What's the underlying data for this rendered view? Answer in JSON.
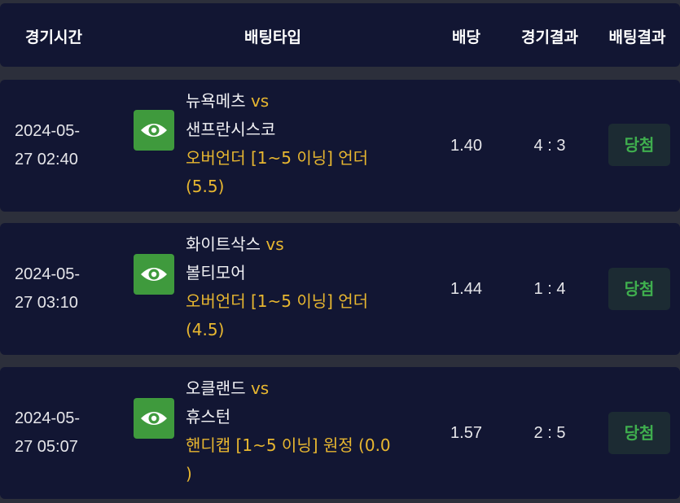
{
  "header": {
    "time": "경기시간",
    "bet_type": "배팅타입",
    "odds": "배당",
    "match_result": "경기결과",
    "bet_result": "배팅결과"
  },
  "rows": [
    {
      "date": "2024-05-",
      "time": "27 02:40",
      "home": "뉴욕메츠",
      "vs": "vs",
      "away": "샌프란시스코",
      "bet_line1": "오버언더 [1~5 이닝] 언더",
      "bet_line2": "(5.5)",
      "odds": "1.40",
      "score": "4 : 3",
      "result": "당첨"
    },
    {
      "date": "2024-05-",
      "time": "27 03:10",
      "home": "화이트삭스",
      "vs": "vs",
      "away": "볼티모어",
      "bet_line1": "오버언더 [1~5 이닝] 언더",
      "bet_line2": "(4.5)",
      "odds": "1.44",
      "score": "1 : 4",
      "result": "당첨"
    },
    {
      "date": "2024-05-",
      "time": "27 05:07",
      "home": "오클랜드",
      "vs": "vs",
      "away": "휴스턴",
      "bet_line1": "핸디캡 [1~5 이닝] 원정 (0.0",
      "bet_line2": ")",
      "odds": "1.57",
      "score": "2 : 5",
      "result": "당첨"
    }
  ],
  "icons": {
    "view": "eye-icon"
  },
  "colors": {
    "panel_bg": "#121633",
    "accent_yellow": "#e8b730",
    "eye_button_green": "#3f9a3d",
    "win_badge_text": "#3fae4e"
  }
}
